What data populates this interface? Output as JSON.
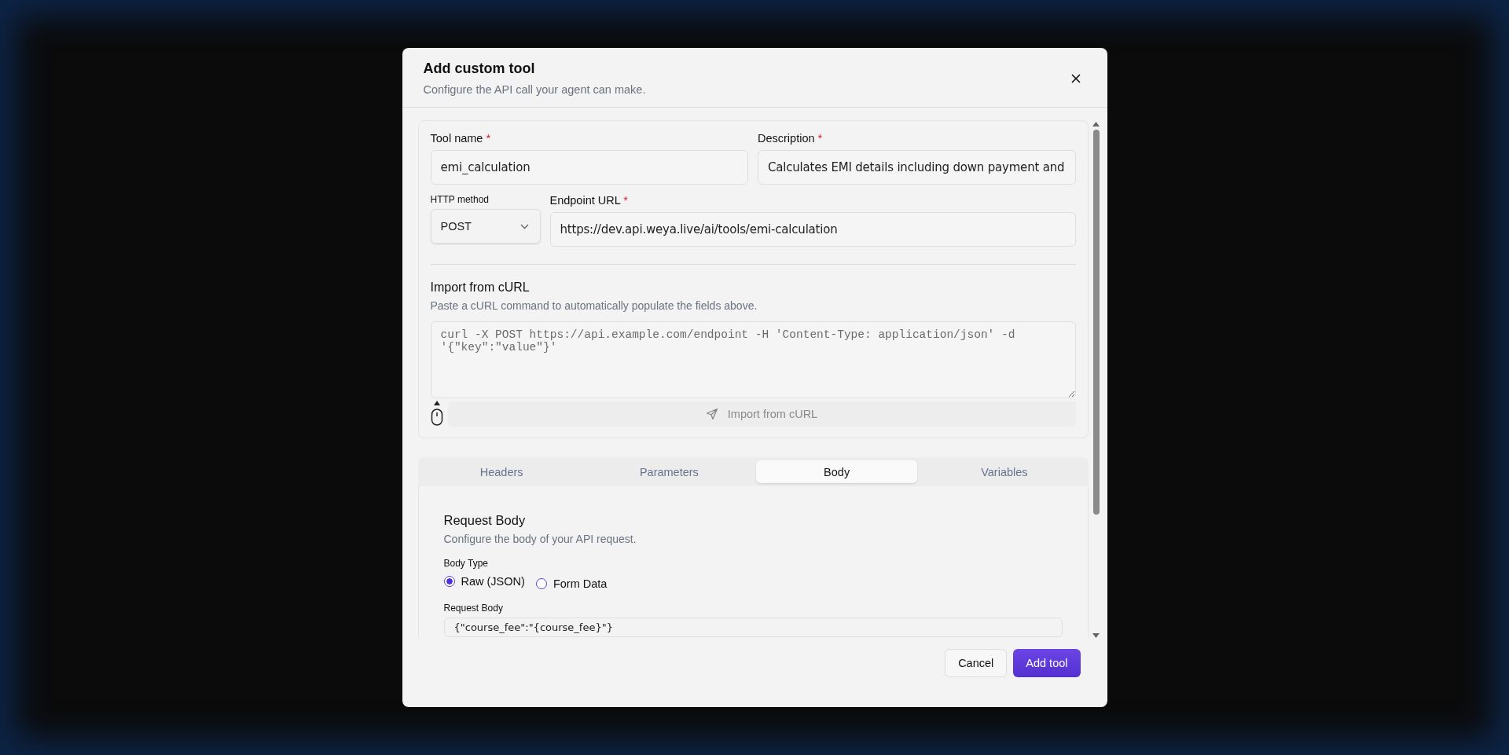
{
  "dialog": {
    "title": "Add custom tool",
    "subtitle": "Configure the API call your agent can make."
  },
  "fields": {
    "tool_name": {
      "label": "Tool name",
      "required_mark": "*",
      "value": "emi_calculation"
    },
    "description": {
      "label": "Description",
      "required_mark": "*",
      "value": "Calculates EMI details including down payment and"
    },
    "http_method": {
      "label": "HTTP method",
      "value": "POST"
    },
    "endpoint_url": {
      "label": "Endpoint URL",
      "required_mark": "*",
      "value": "https://dev.api.weya.live/ai/tools/emi-calculation"
    }
  },
  "import_curl": {
    "title": "Import from cURL",
    "subtitle": "Paste a cURL command to automatically populate the fields above.",
    "placeholder": "curl -X POST https://api.example.com/endpoint -H 'Content-Type: application/json' -d '{\"key\":\"value\"}'",
    "button": "Import from cURL"
  },
  "tabs": [
    {
      "label": "Headers",
      "selected": false
    },
    {
      "label": "Parameters",
      "selected": false
    },
    {
      "label": "Body",
      "selected": true
    },
    {
      "label": "Variables",
      "selected": false
    }
  ],
  "body": {
    "title": "Request Body",
    "subtitle": "Configure the body of your API request.",
    "type_label": "Body Type",
    "types": [
      {
        "label": "Raw (JSON)",
        "selected": true
      },
      {
        "label": "Form Data",
        "selected": false
      }
    ],
    "request_label": "Request Body",
    "request_value": "{\"course_fee\":\"{course_fee}\"}"
  },
  "buttons": {
    "cancel": "Cancel",
    "submit": "Add tool"
  }
}
